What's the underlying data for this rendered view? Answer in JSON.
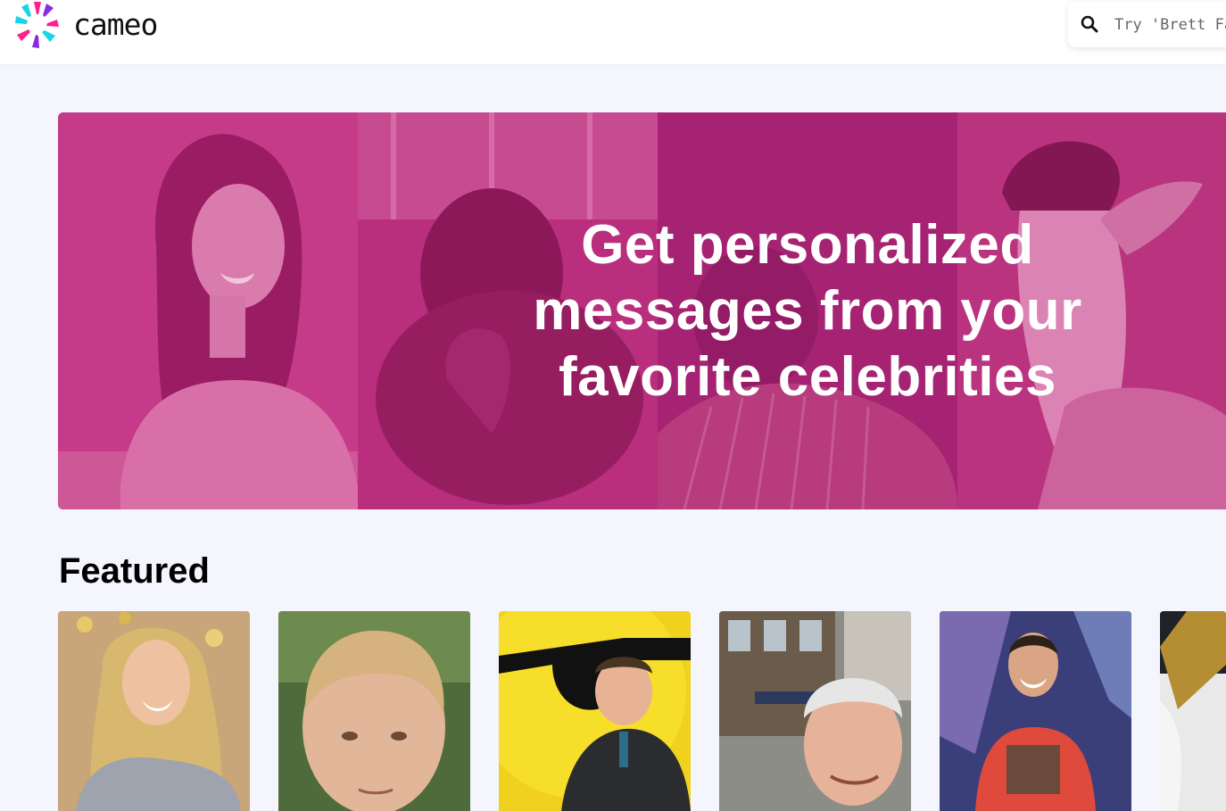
{
  "header": {
    "logo_text": "cameo",
    "search": {
      "placeholder": "Try 'Brett Fav"
    }
  },
  "hero": {
    "title_lines": [
      "Get personalized",
      "messages from your",
      "favorite celebrities"
    ]
  },
  "featured": {
    "title": "Featured"
  },
  "colors": {
    "page_background": "#f4f5fd",
    "hero_tint": "#c2327f",
    "logo_pink": "#ff1f8e",
    "logo_cyan": "#19d3e6",
    "logo_purple": "#8a2be2"
  }
}
